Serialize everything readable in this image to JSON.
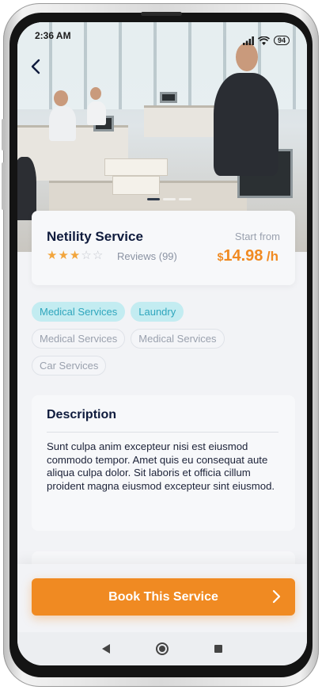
{
  "status": {
    "time": "2:36 AM",
    "battery": "94"
  },
  "service": {
    "name": "Netility Service",
    "rating": 3,
    "rating_max": 5,
    "reviews_label": "Reviews (99)",
    "start_from_label": "Start from",
    "price_currency": "$",
    "price_amount": "14.98",
    "price_unit": "/h"
  },
  "tags": [
    {
      "label": "Medical Services",
      "selected": true
    },
    {
      "label": "Laundry",
      "selected": true
    },
    {
      "label": "Medical Services",
      "selected": false
    },
    {
      "label": "Medical Services",
      "selected": false
    },
    {
      "label": "Car Services",
      "selected": false
    }
  ],
  "description": {
    "title": "Description",
    "text": "Sunt culpa anim excepteur nisi est eiusmod commodo tempor. Amet quis eu consequat aute aliqua culpa dolor. Sit laboris et officia cillum proident magna eiusmod excepteur sint eiusmod."
  },
  "cta": {
    "label": "Book This Service"
  },
  "colors": {
    "accent": "#f08a22",
    "tag_selected_bg": "#c3ecf1",
    "tag_selected_text": "#2fa6bd",
    "heading": "#0f1b3d"
  },
  "icons": {
    "back": "chevron-left-icon",
    "cta": "chevron-right-icon",
    "wifi": "wifi-icon",
    "signal": "signal-icon",
    "battery": "battery-icon",
    "star": "star-icon"
  }
}
